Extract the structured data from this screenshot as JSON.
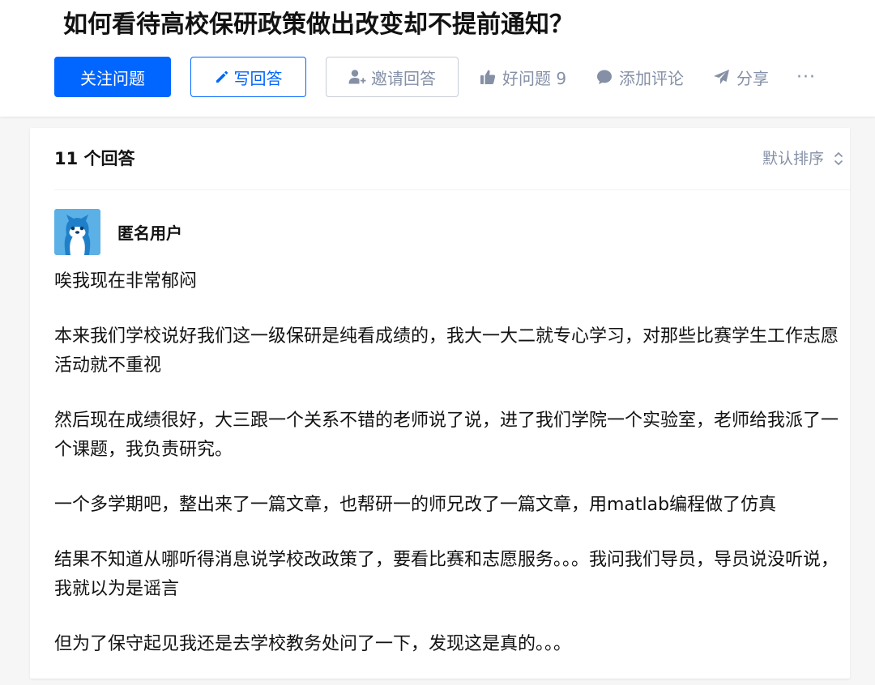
{
  "question": {
    "title": "如何看待高校保研政策做出改变却不提前通知？"
  },
  "actions": {
    "follow_label": "关注问题",
    "write_answer_label": "写回答",
    "invite_label": "邀请回答",
    "good_question_label": "好问题 9",
    "comment_label": "添加评论",
    "share_label": "分享",
    "more_label": "···"
  },
  "answers_header": {
    "count_label": "11 个回答",
    "sort_label": "默认排序"
  },
  "answer": {
    "author_name": "匿名用户",
    "paragraphs": [
      "唉我现在非常郁闷",
      "本来我们学校说好我们这一级保研是纯看成绩的，我大一大二就专心学习，对那些比赛学生工作志愿活动就不重视",
      "然后现在成绩很好，大三跟一个关系不错的老师说了说，进了我们学院一个实验室，老师给我派了一个课题，我负责研究。",
      "一个多学期吧，整出来了一篇文章，也帮研一的师兄改了一篇文章，用matlab编程做了仿真",
      "结果不知道从哪听得消息说学校改政策了，要看比赛和志愿服务。。。我问我们导员，导员说没听说，我就以为是谣言",
      "但为了保守起见我还是去学校教务处问了一下，发现这是真的。。。"
    ]
  },
  "colors": {
    "brand_blue": "#0066ff",
    "muted_gray": "#8590a6",
    "avatar_bg": "#5bb0e6"
  },
  "icons": {
    "write_answer": "pencil-icon",
    "invite": "add-user-icon",
    "good_question": "thumbs-up-icon",
    "comment": "comment-bubble-icon",
    "share": "paper-plane-icon",
    "sort": "up-down-chevron-icon",
    "avatar": "anonymous-avatar"
  }
}
